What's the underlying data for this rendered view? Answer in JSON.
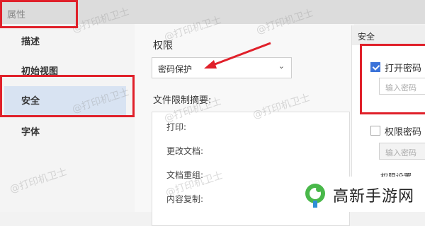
{
  "header": {
    "title": "属性"
  },
  "nav": {
    "items": [
      {
        "label": "描述"
      },
      {
        "label": "初始视图"
      },
      {
        "label": "安全"
      },
      {
        "label": "字体"
      }
    ]
  },
  "permissions": {
    "title": "权限",
    "select_value": "密码保护",
    "summary_title": "文件限制摘要:",
    "summary_rows": [
      "打印:",
      "更改文档:",
      "文档重组:",
      "内容复制:"
    ]
  },
  "security": {
    "title": "安全",
    "open_password_label": "打开密码",
    "open_password_checked": true,
    "open_password_placeholder": "输入密码",
    "permission_password_label": "权限密码",
    "permission_password_checked": false,
    "permission_password_placeholder": "输入密码",
    "cut_text": "权限设置"
  },
  "watermark": {
    "text": "@打印机卫士"
  },
  "logo": {
    "text": "高新手游网"
  },
  "colors": {
    "accent": "#3b73d9",
    "annotation": "#e0202a",
    "nav_active": "#d8e3f2"
  }
}
